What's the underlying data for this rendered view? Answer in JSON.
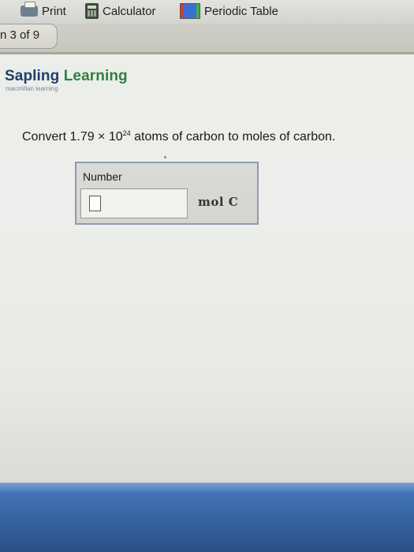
{
  "toolbar": {
    "print_label": "Print",
    "calculator_label": "Calculator",
    "periodic_table_label": "Periodic Table"
  },
  "question_nav": {
    "label": "n 3 of 9"
  },
  "logo": {
    "name_part1": "Sapling ",
    "name_part2": "Learning",
    "tagline": "macmillan learning"
  },
  "question": {
    "prefix": "Convert 1.79 × 10",
    "exponent": "24",
    "suffix": " atoms of carbon to moles of carbon."
  },
  "answer": {
    "label": "Number",
    "value": "",
    "unit": "mol  C"
  },
  "colors": {
    "logo_blue": "#1f3f6a",
    "logo_green": "#2f7f3f",
    "answer_border": "#8e9bb0"
  }
}
